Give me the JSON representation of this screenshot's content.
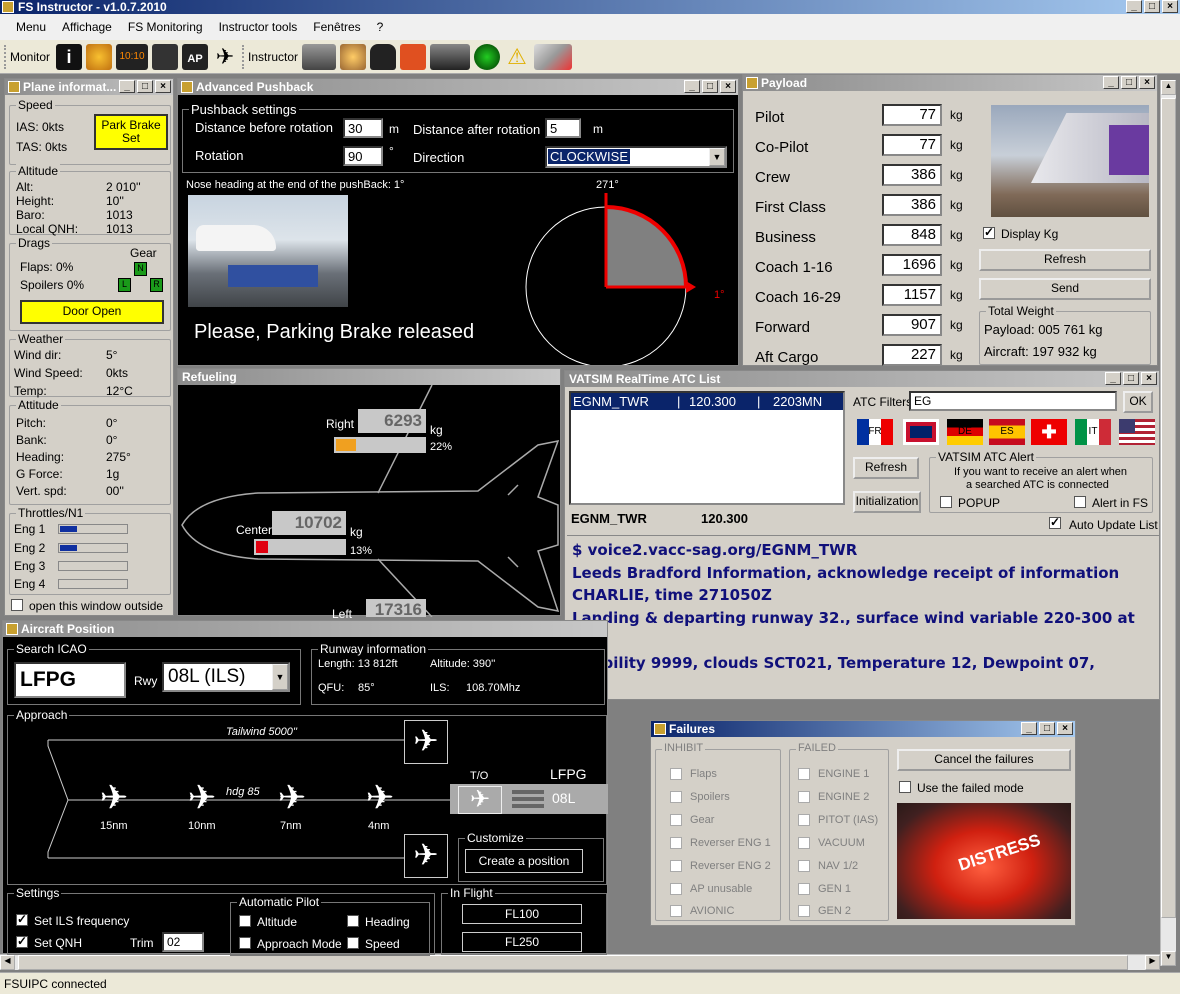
{
  "app": {
    "title": "FS Instructor - v1.0.7.2010"
  },
  "menu": [
    "Menu",
    "Affichage",
    "FS Monitoring",
    "Instructor tools",
    "Fenêtres",
    "?"
  ],
  "toolbar": {
    "monitor": "Monitor",
    "instructor": "Instructor",
    "clock": "10:10"
  },
  "plane_info": {
    "title": "Plane informat...",
    "speed": "Speed",
    "ias": "IAS:  0kts",
    "tas": "TAS:  0kts",
    "park_brake": "Park Brake Set",
    "altitude": "Altitude",
    "alt_l": "Alt:",
    "alt_v": "2 010''",
    "height_l": "Height:",
    "height_v": "10''",
    "baro_l": "Baro:",
    "baro_v": "1013",
    "qnh_l": "Local QNH:",
    "qnh_v": "1013",
    "drags": "Drags",
    "gear": "Gear",
    "gear_n": "N",
    "gear_l": "L",
    "gear_r": "R",
    "flaps": "Flaps:  0%",
    "spoilers": "Spoilers 0%",
    "door": "Door Open",
    "weather": "Weather",
    "wdir_l": "Wind dir:",
    "wdir_v": "5°",
    "wspd_l": "Wind Speed:",
    "wspd_v": "0kts",
    "temp_l": "Temp:",
    "temp_v": "12°C",
    "attitude": "Attitude",
    "pitch_l": "Pitch:",
    "pitch_v": "0°",
    "bank_l": "Bank:",
    "bank_v": "0°",
    "head_l": "Heading:",
    "head_v": "275°",
    "g_l": "G Force:",
    "g_v": "1g",
    "vs_l": "Vert. spd:",
    "vs_v": "00''",
    "throttles": "Throttles/N1",
    "eng1": "Eng 1",
    "eng2": "Eng 2",
    "eng3": "Eng 3",
    "eng4": "Eng 4",
    "eng_levels": [
      0.25,
      0.25,
      0,
      0
    ],
    "outside": "open this window outside"
  },
  "pushback": {
    "title": "Advanced Pushback",
    "settings": "Pushback settings",
    "dist_before": "Distance before rotation",
    "dist_before_v": "30",
    "m1": "m",
    "dist_after": "Distance after rotation",
    "dist_after_v": "5",
    "m2": "m",
    "rotation": "Rotation",
    "rotation_v": "90",
    "deg": "°",
    "direction": "Direction",
    "direction_v": "CLOCKWISE",
    "nose": "Nose heading at the end of the pushBack: 1°",
    "hdg271": "271°",
    "hdg1": "1°",
    "msg": "Please, Parking Brake released"
  },
  "payload": {
    "title": "Payload",
    "rows": [
      {
        "label": "Pilot",
        "value": "77"
      },
      {
        "label": "Co-Pilot",
        "value": "77"
      },
      {
        "label": "Crew",
        "value": "386"
      },
      {
        "label": "First Class",
        "value": "386"
      },
      {
        "label": "Business",
        "value": "848"
      },
      {
        "label": "Coach 1-16",
        "value": "1696"
      },
      {
        "label": "Coach 16-29",
        "value": "1157"
      },
      {
        "label": "Forward",
        "value": "907"
      },
      {
        "label": "Aft Cargo",
        "value": "227"
      }
    ],
    "unit": "kg",
    "display_kg": "Display Kg",
    "refresh": "Refresh",
    "send": "Send",
    "total": "Total Weight",
    "payload_l": "Payload: 005 761 kg",
    "aircraft_l": "Aircraft:  197 932 kg"
  },
  "refuel": {
    "title": "Refueling",
    "right": "Right",
    "right_v": "6293",
    "right_pct": "22%",
    "right_frac": 0.22,
    "center": "Center",
    "center_v": "10702",
    "center_pct": "13%",
    "center_frac": 0.13,
    "left": "Left",
    "left_v": "17316",
    "kg": "kg"
  },
  "vatsim": {
    "title": "VATSIM RealTime ATC List",
    "row": {
      "a": "EGNM_TWR",
      "b": "120.300",
      "c": "2203MN"
    },
    "filters": "ATC Filters",
    "filter_v": "EG",
    "ok": "OK",
    "flags": [
      "FR",
      "UK",
      "DE",
      "ES",
      "CH",
      "IT",
      "US"
    ],
    "refresh": "Refresh",
    "init": "Initialization",
    "alert": "VATSIM ATC Alert",
    "alert_txt1": "If you want to receive an alert when",
    "alert_txt2": "a searched ATC is connected",
    "popup": "POPUP",
    "alert_fs": "Alert in FS",
    "sel_name": "EGNM_TWR",
    "sel_freq": "120.300",
    "auto": "Auto Update List",
    "lines": [
      "$ voice2.vacc-sag.org/EGNM_TWR",
      "Leeds Bradford Information, acknowledge receipt of information",
      "CHARLIE, time 271050Z",
      "Landing & departing runway 32., surface wind variable 220-300 at",
      "22",
      "Visibility 9999, clouds SCT021, Temperature 12, Dewpoint 07,"
    ]
  },
  "acpos": {
    "title": "Aircraft Position",
    "search": "Search ICAO",
    "icao": "LFPG",
    "rwy": "Rwy",
    "rwy_v": "08L (ILS)",
    "rinfo": "Runway information",
    "length": "Length: 13 812ft",
    "altitude": "Altitude: 390''",
    "qfu": "QFU:",
    "qfu_v": "85°",
    "ils": "ILS:",
    "ils_v": "108.70Mhz",
    "approach": "Approach",
    "tailwind": "Tailwind 5000''",
    "hdg": "hdg 85",
    "d15": "15nm",
    "d10": "10nm",
    "d7": "7nm",
    "d4": "4nm",
    "to": "T/O",
    "apt": "LFPG",
    "rwylbl": "08L",
    "customize": "Customize",
    "create": "Create a position",
    "settings": "Settings",
    "set_ils": "Set ILS frequency",
    "set_qnh": "Set QNH",
    "trim": "Trim",
    "trim_v": "02",
    "autop": "Automatic Pilot",
    "ap_alt": "Altitude",
    "ap_hdg": "Heading",
    "ap_app": "Approach Mode",
    "ap_spd": "Speed",
    "inflight": "In Flight",
    "fl100": "FL100",
    "fl250": "FL250"
  },
  "failures": {
    "title": "Failures",
    "inhibit": "INHIBIT",
    "failed": "FAILED",
    "inhibit_items": [
      "Flaps",
      "Spoilers",
      "Gear",
      "Reverser ENG 1",
      "Reverser ENG 2",
      "AP unusable",
      "AVIONIC"
    ],
    "failed_items": [
      "ENGINE 1",
      "ENGINE 2",
      "PITOT (IAS)",
      "VACUUM",
      "NAV 1/2",
      "GEN 1",
      "GEN 2"
    ],
    "cancel": "Cancel the failures",
    "use_failed": "Use the failed mode",
    "distress": "DISTRESS"
  },
  "status": {
    "text": "FSUIPC connected"
  }
}
